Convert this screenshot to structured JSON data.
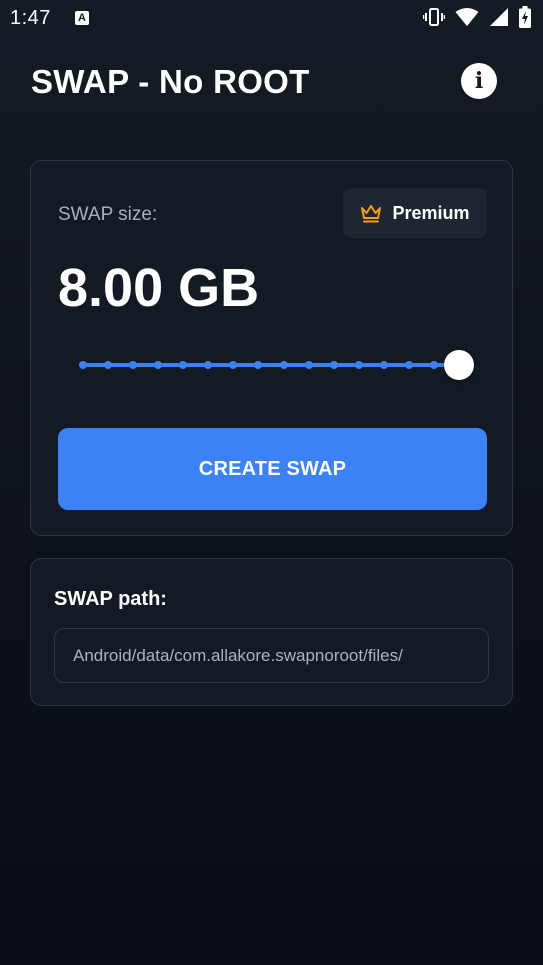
{
  "status_bar": {
    "time": "1:47",
    "app_icon_glyph": "A",
    "icons": [
      "vibrate-icon",
      "wifi-icon",
      "signal-icon",
      "battery-charging-icon"
    ]
  },
  "header": {
    "title": "SWAP - No ROOT",
    "info_icon_glyph": "i"
  },
  "size_card": {
    "label": "SWAP size:",
    "premium_label": "Premium",
    "value": "8.00 GB",
    "slider": {
      "steps": 16,
      "position": 1.0
    },
    "create_button_label": "CREATE SWAP"
  },
  "path_card": {
    "label": "SWAP path:",
    "value": "Android/data/com.allakore.swapnoroot/files/"
  },
  "colors": {
    "accent": "#3b82f6",
    "premium_crown": "#f59e0b",
    "card_bg": "#131a23",
    "card_border": "#2b3644"
  }
}
